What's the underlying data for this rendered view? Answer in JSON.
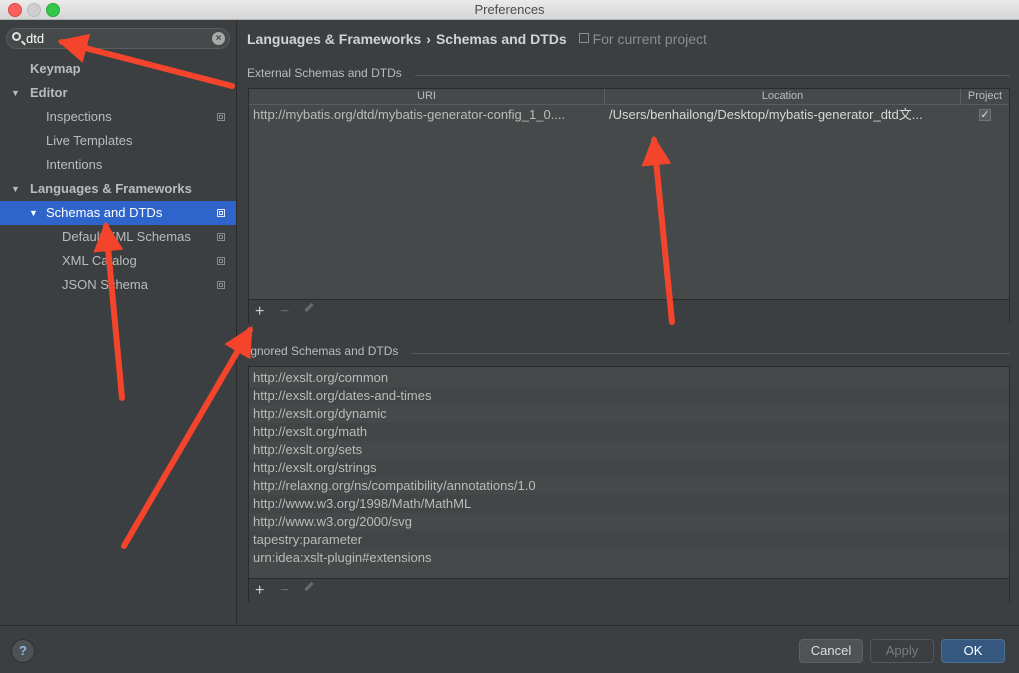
{
  "window": {
    "title": "Preferences"
  },
  "sidebar": {
    "search": {
      "value": "dtd"
    },
    "items": [
      {
        "label": "Keymap"
      },
      {
        "label": "Editor"
      },
      {
        "label": "Inspections"
      },
      {
        "label": "Live Templates"
      },
      {
        "label": "Intentions"
      },
      {
        "label": "Languages & Frameworks"
      },
      {
        "label": "Schemas and DTDs"
      },
      {
        "label": "Default XML Schemas"
      },
      {
        "label": "XML Catalog"
      },
      {
        "label": "JSON Schema"
      }
    ]
  },
  "breadcrumb": {
    "parent": "Languages & Frameworks",
    "separator": "›",
    "current": "Schemas and DTDs",
    "scope": "For current project"
  },
  "external": {
    "title": "External Schemas and DTDs",
    "columns": {
      "uri": "URI",
      "location": "Location",
      "project": "Project"
    },
    "rows": [
      {
        "uri": "http://mybatis.org/dtd/mybatis-generator-config_1_0....",
        "location": "/Users/benhailong/Desktop/mybatis-generator_dtd文...",
        "project": "✓"
      }
    ]
  },
  "ignored": {
    "title": "Ignored Schemas and DTDs",
    "rows": [
      "http://exslt.org/common",
      "http://exslt.org/dates-and-times",
      "http://exslt.org/dynamic",
      "http://exslt.org/math",
      "http://exslt.org/sets",
      "http://exslt.org/strings",
      "http://relaxng.org/ns/compatibility/annotations/1.0",
      "http://www.w3.org/1998/Math/MathML",
      "http://www.w3.org/2000/svg",
      "tapestry:parameter",
      "urn:idea:xslt-plugin#extensions"
    ]
  },
  "toolbar": {
    "add": "+",
    "remove": "−"
  },
  "footer": {
    "help": "?",
    "cancel": "Cancel",
    "apply": "Apply",
    "ok": "OK"
  },
  "colors": {
    "selection": "#2f65ca",
    "annotation": "#f4452c",
    "ok_button": "#365880"
  },
  "icons": [
    "search-icon",
    "clear-icon",
    "project-scope-icon",
    "edit-icon",
    "help-icon"
  ]
}
